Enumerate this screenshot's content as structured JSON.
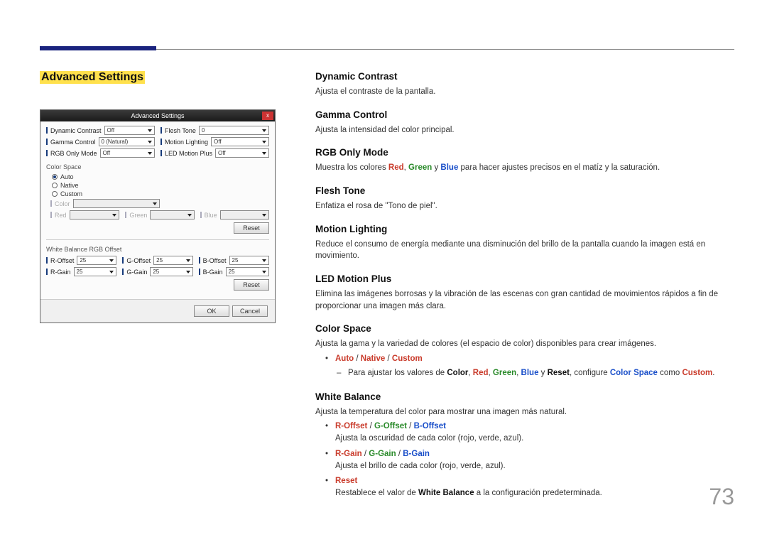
{
  "page_number": "73",
  "section_title": "Advanced Settings",
  "screenshot": {
    "title": "Advanced Settings",
    "close": "x",
    "rows_left": [
      {
        "label": "Dynamic Contrast",
        "value": "Off"
      },
      {
        "label": "Gamma Control",
        "value": "0 (Natural)"
      },
      {
        "label": "RGB Only Mode",
        "value": "Off"
      }
    ],
    "rows_right": [
      {
        "label": "Flesh Tone",
        "value": "0"
      },
      {
        "label": "Motion Lighting",
        "value": "Off"
      },
      {
        "label": "LED Motion Plus",
        "value": "Off"
      }
    ],
    "color_space": {
      "title": "Color Space",
      "options": [
        "Auto",
        "Native",
        "Custom"
      ],
      "selected": "Auto",
      "color_label": "Color",
      "red_label": "Red",
      "green_label": "Green",
      "blue_label": "Blue",
      "reset": "Reset"
    },
    "white_balance": {
      "title": "White Balance RGB Offset",
      "offsets": [
        {
          "label": "R-Offset",
          "value": "25"
        },
        {
          "label": "G-Offset",
          "value": "25"
        },
        {
          "label": "B-Offset",
          "value": "25"
        }
      ],
      "gains": [
        {
          "label": "R-Gain",
          "value": "25"
        },
        {
          "label": "G-Gain",
          "value": "25"
        },
        {
          "label": "B-Gain",
          "value": "25"
        }
      ],
      "reset": "Reset"
    },
    "ok": "OK",
    "cancel": "Cancel"
  },
  "right": {
    "dynamic_contrast": {
      "title": "Dynamic Contrast",
      "desc": "Ajusta el contraste de la pantalla."
    },
    "gamma_control": {
      "title": "Gamma Control",
      "desc": "Ajusta la intensidad del color principal."
    },
    "rgb_only": {
      "title": "RGB Only Mode",
      "pre": "Muestra los colores ",
      "red": "Red",
      "comma1": ", ",
      "green": "Green",
      "y": " y ",
      "blue": "Blue",
      "post": " para hacer ajustes precisos en el matíz y la saturación."
    },
    "flesh_tone": {
      "title": "Flesh Tone",
      "desc": "Enfatiza el rosa de \"Tono de piel\"."
    },
    "motion_lighting": {
      "title": "Motion Lighting",
      "desc": "Reduce el consumo de energía mediante una disminución del brillo de la pantalla cuando la imagen está en movimiento."
    },
    "led_motion_plus": {
      "title": "LED Motion Plus",
      "desc": "Elimina las imágenes borrosas y la vibración de las escenas con gran cantidad de movimientos rápidos a fin de proporcionar una imagen más clara."
    },
    "color_space": {
      "title": "Color Space",
      "desc": "Ajusta la gama y la variedad de colores (el espacio de color) disponibles para crear imágenes.",
      "bullet_auto": "Auto",
      "sep": " / ",
      "bullet_native": "Native",
      "bullet_custom": "Custom",
      "sub_pre": "Para ajustar los valores de ",
      "color": "Color",
      "c1": ", ",
      "red": "Red",
      "c2": ", ",
      "green": "Green",
      "c3": ", ",
      "blue": "Blue",
      "c4": " y ",
      "reset": "Reset",
      "conf": ", configure ",
      "cs": "Color Space",
      "como": " como ",
      "custom2": "Custom",
      "dot": "."
    },
    "white_balance": {
      "title": "White Balance",
      "desc": "Ajusta la temperatura del color para mostrar una imagen más natural.",
      "off_r": "R-Offset",
      "off_g": "G-Offset",
      "off_b": "B-Offset",
      "off_desc": "Ajusta la oscuridad de cada color (rojo, verde, azul).",
      "gain_r": "R-Gain",
      "gain_g": "G-Gain",
      "gain_b": "B-Gain",
      "gain_desc": "Ajusta el brillo de cada color (rojo, verde, azul).",
      "reset": "Reset",
      "reset_pre": "Restablece el valor de ",
      "reset_wb": "White Balance",
      "reset_post": " a la configuración predeterminada."
    }
  }
}
